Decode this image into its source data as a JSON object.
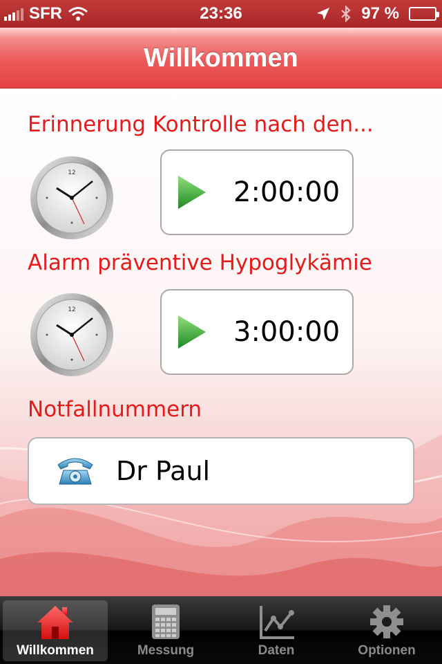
{
  "status_bar": {
    "carrier": "SFR",
    "time": "23:36",
    "battery": "97 %",
    "battery_level": 0.97
  },
  "nav": {
    "title": "Willkommen"
  },
  "sections": {
    "reminder_label": "Erinnerung Kontrolle nach den...",
    "reminder_time": "2:00:00",
    "alarm_label": "Alarm präventive Hypoglykämie",
    "alarm_time": "3:00:00",
    "emergency_label": "Notfallnummern",
    "contact_name": "Dr Paul"
  },
  "tabs": [
    {
      "label": "Willkommen",
      "icon": "house-icon",
      "active": true
    },
    {
      "label": "Messung",
      "icon": "calculator-icon",
      "active": false
    },
    {
      "label": "Daten",
      "icon": "chart-icon",
      "active": false
    },
    {
      "label": "Optionen",
      "icon": "gear-icon",
      "active": false
    }
  ],
  "colors": {
    "accent_red": "#e41b1b",
    "nav_red": "#e24242",
    "status_bar": "#b02d2d"
  }
}
